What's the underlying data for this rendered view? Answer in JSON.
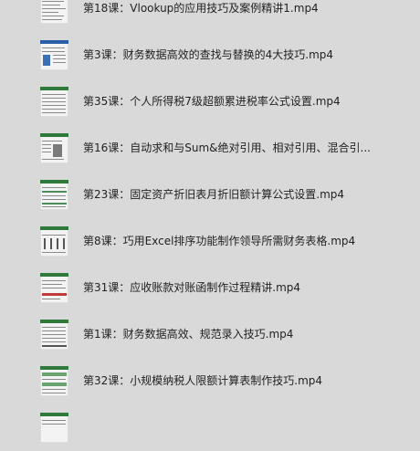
{
  "playlist": {
    "items": [
      {
        "title": "第18课：Vlookup的应用技巧及案例精讲1.mp4",
        "thumb_icon": "spreadsheet-thumbnail"
      },
      {
        "title": "第3课：财务数据高效的查找与替换的4大技巧.mp4",
        "thumb_icon": "spreadsheet-thumbnail"
      },
      {
        "title": "第35课：个人所得税7级超额累进税率公式设置.mp4",
        "thumb_icon": "spreadsheet-thumbnail"
      },
      {
        "title": "第16课：自动求和与Sum&绝对引用、相对引用、混合引...",
        "thumb_icon": "spreadsheet-thumbnail"
      },
      {
        "title": "第23课：固定资产折旧表月折旧额计算公式设置.mp4",
        "thumb_icon": "spreadsheet-thumbnail"
      },
      {
        "title": "第8课：巧用Excel排序功能制作领导所需财务表格.mp4",
        "thumb_icon": "spreadsheet-thumbnail"
      },
      {
        "title": "第31课：应收账款对账函制作过程精讲.mp4",
        "thumb_icon": "spreadsheet-thumbnail"
      },
      {
        "title": "第1课：财务数据高效、规范录入技巧.mp4",
        "thumb_icon": "spreadsheet-thumbnail"
      },
      {
        "title": "第32课：小规模纳税人限额计算表制作技巧.mp4",
        "thumb_icon": "spreadsheet-thumbnail"
      },
      {
        "title": "",
        "thumb_icon": "spreadsheet-thumbnail"
      }
    ]
  },
  "colors": {
    "background": "#d9d9d9",
    "text": "#222222",
    "thumb_accent": "#2f7a3a"
  }
}
